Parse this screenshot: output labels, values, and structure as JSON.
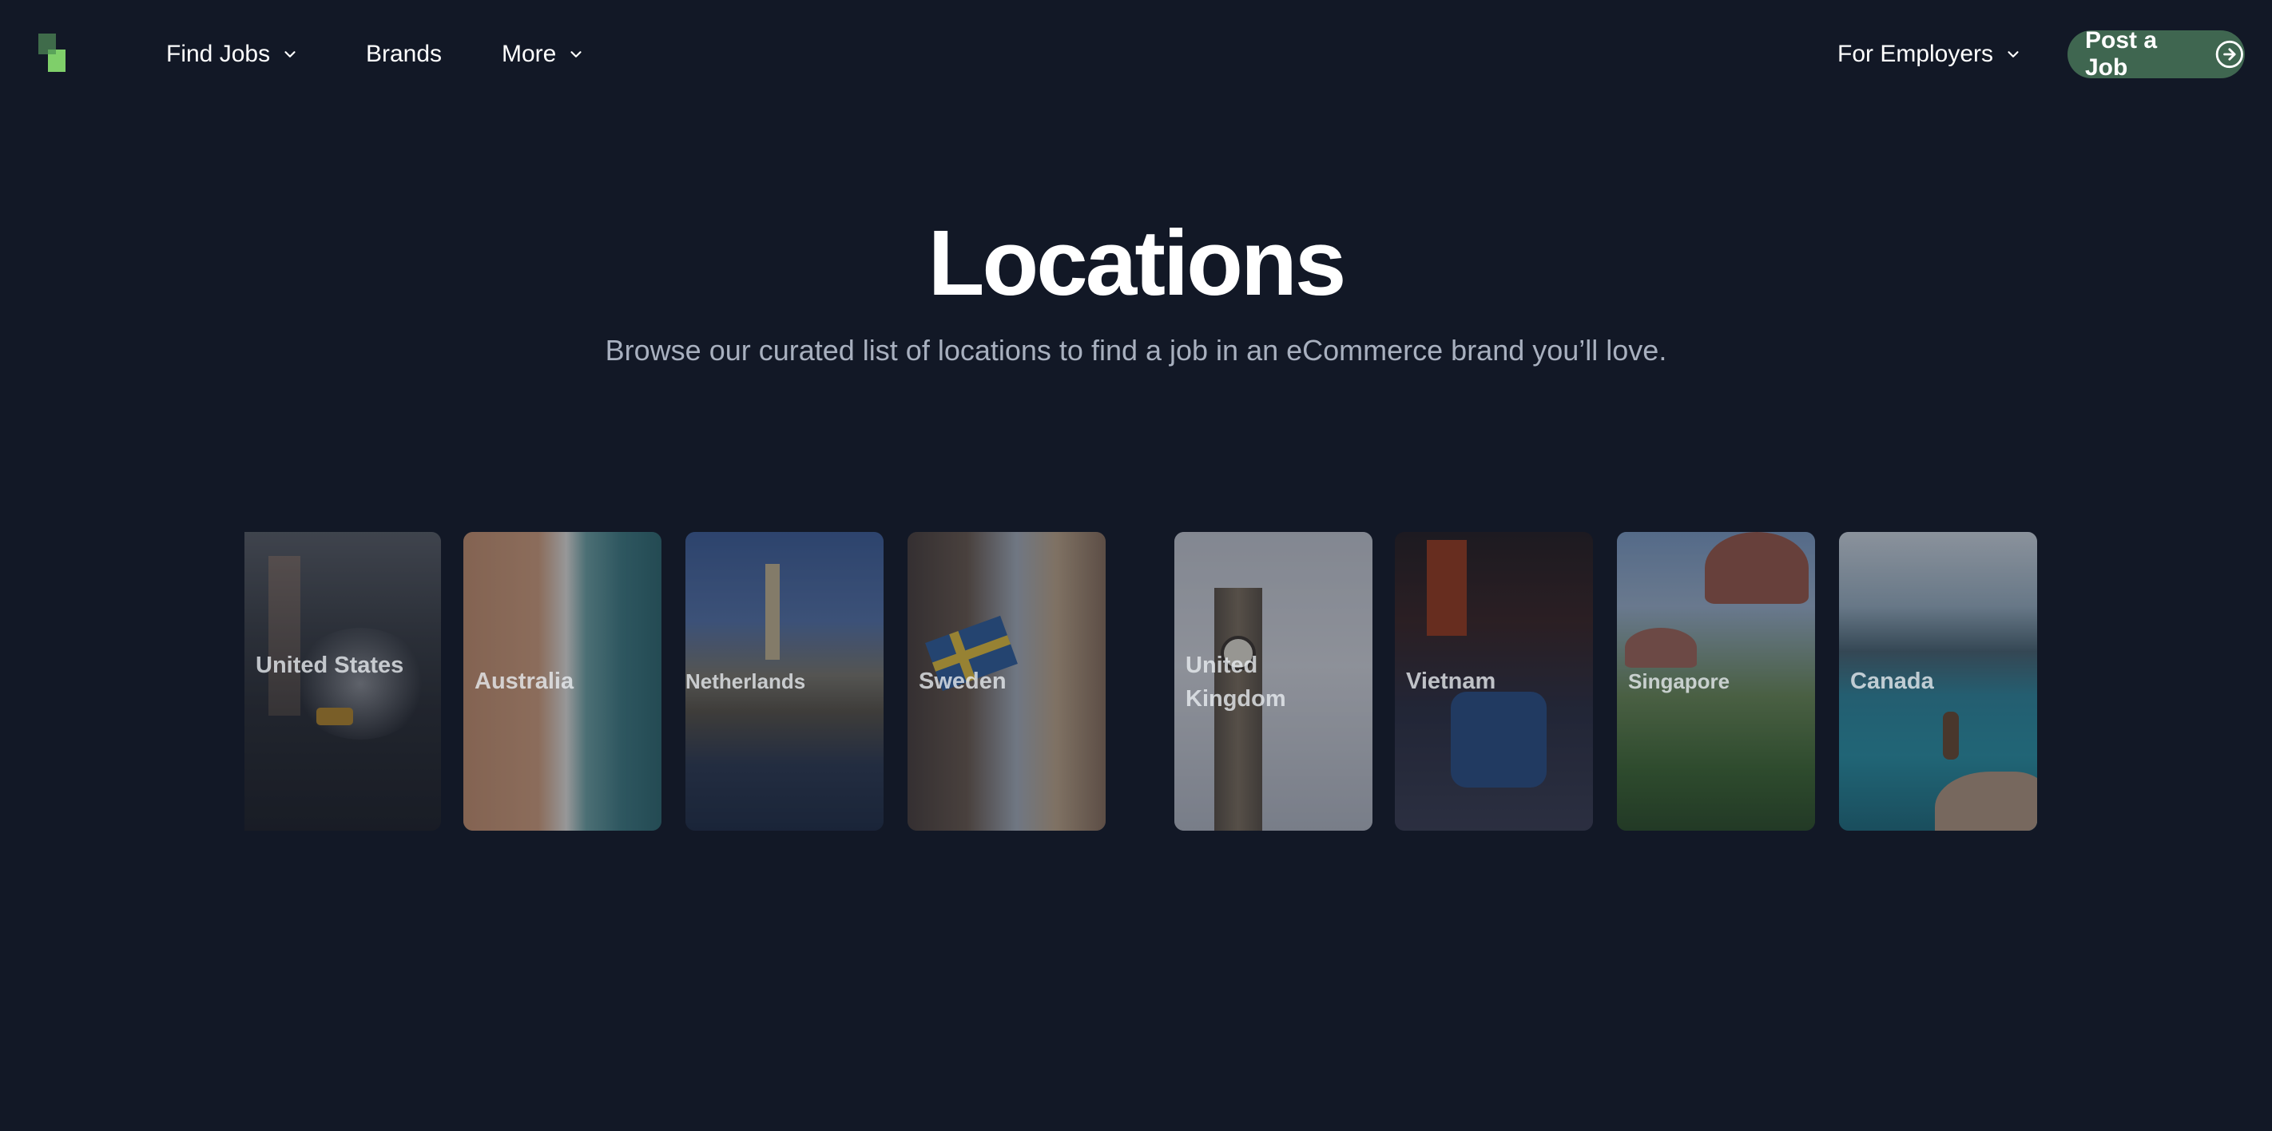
{
  "nav": {
    "logo_icon": "logo-icon",
    "find_jobs": "Find Jobs",
    "brands": "Brands",
    "more": "More",
    "for_employers": "For Employers",
    "post_job": "Post a Job"
  },
  "hero": {
    "title": "Locations",
    "subtitle": "Browse our curated list of locations to find a job in an eCommerce brand you’ll love."
  },
  "locations": [
    {
      "name": "United States"
    },
    {
      "name": "Australia"
    },
    {
      "name": "Netherlands"
    },
    {
      "name": "Sweden"
    },
    {
      "name": "United Kingdom"
    },
    {
      "name": "Vietnam"
    },
    {
      "name": "Singapore"
    },
    {
      "name": "Canada"
    }
  ],
  "colors": {
    "background": "#121826",
    "post_button": "#3f6650",
    "subtitle_text": "#a8b0bf",
    "logo_green_dark": "#3f6b4a",
    "logo_green_light": "#7fcf6a"
  }
}
